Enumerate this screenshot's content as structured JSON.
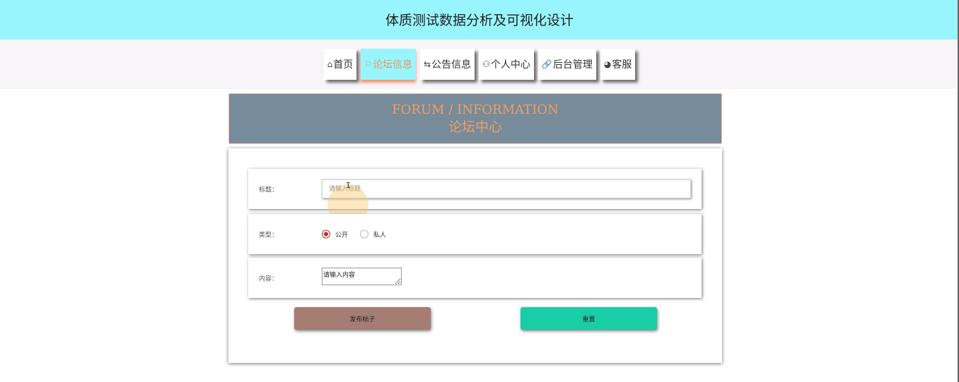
{
  "header": {
    "title": "体质测试数据分析及可视化设计"
  },
  "nav": {
    "items": [
      {
        "icon": "⌂",
        "label": "首页"
      },
      {
        "icon": "⚐",
        "label": "论坛信息"
      },
      {
        "icon": "⇆",
        "label": "公告信息"
      },
      {
        "icon": "⚇",
        "label": "个人中心"
      },
      {
        "icon": "🔗",
        "label": "后台管理"
      },
      {
        "icon": "◕",
        "label": "客服"
      }
    ],
    "active_index": 1
  },
  "banner": {
    "en": "FORUM / INFORMATION",
    "cn": "论坛中心"
  },
  "form": {
    "title_label": "标题：",
    "title_placeholder": "请输入标题",
    "type_label": "类型：",
    "type_options": [
      "公开",
      "私人"
    ],
    "type_selected": "公开",
    "content_label": "内容：",
    "content_value": "请输入内容",
    "publish_label": "发布帖子",
    "reset_label": "重置"
  },
  "colors": {
    "header_bg": "#99f5fd",
    "accent_orange": "#f0a061",
    "banner_bg": "#778b9a",
    "publish_bg": "#a57d73",
    "reset_bg": "#19cda6",
    "radio_selected": "#c0282d"
  }
}
